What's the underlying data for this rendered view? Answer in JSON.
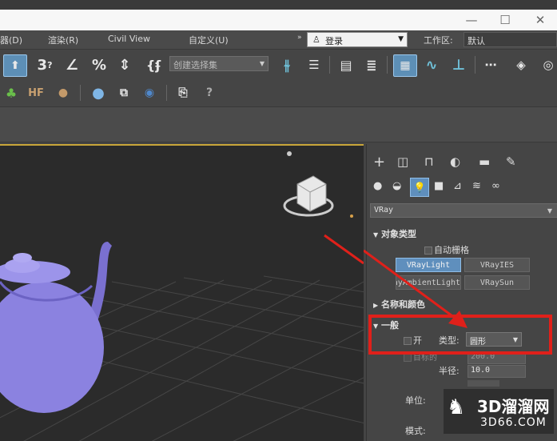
{
  "menubar": {
    "items": [
      "器(D)",
      "渲染(R)",
      "Civil View",
      "自定义(U)"
    ],
    "login": "登录",
    "workspace_label": "工作区:",
    "workspace_value": "默认"
  },
  "toolbar": {
    "selection_set_placeholder": "创建选择集"
  },
  "command_panel": {
    "object_dropdown": "VRay",
    "object_type": {
      "title": "对象类型",
      "auto_grid": "自动栅格",
      "buttons": [
        "VRayLight",
        "VRayIES",
        "VRayAmbientLight",
        "VRaySun"
      ]
    },
    "name_color": {
      "title": "名称和颜色"
    },
    "general": {
      "title": "一般",
      "on_label": "开",
      "type_label": "类型:",
      "type_value": "圆形",
      "target_label": "目标的",
      "target_value": "200.0",
      "radius_label": "半径:",
      "radius_value": "10.0",
      "unit_label": "单位:",
      "mode_label": "模式:"
    }
  },
  "watermark": {
    "text": "3D溜溜网",
    "url": "3D66.COM"
  },
  "colors": {
    "accent": "#5f8fbd",
    "highlight_box": "#e0201a",
    "teapot": "#8b82e0"
  }
}
